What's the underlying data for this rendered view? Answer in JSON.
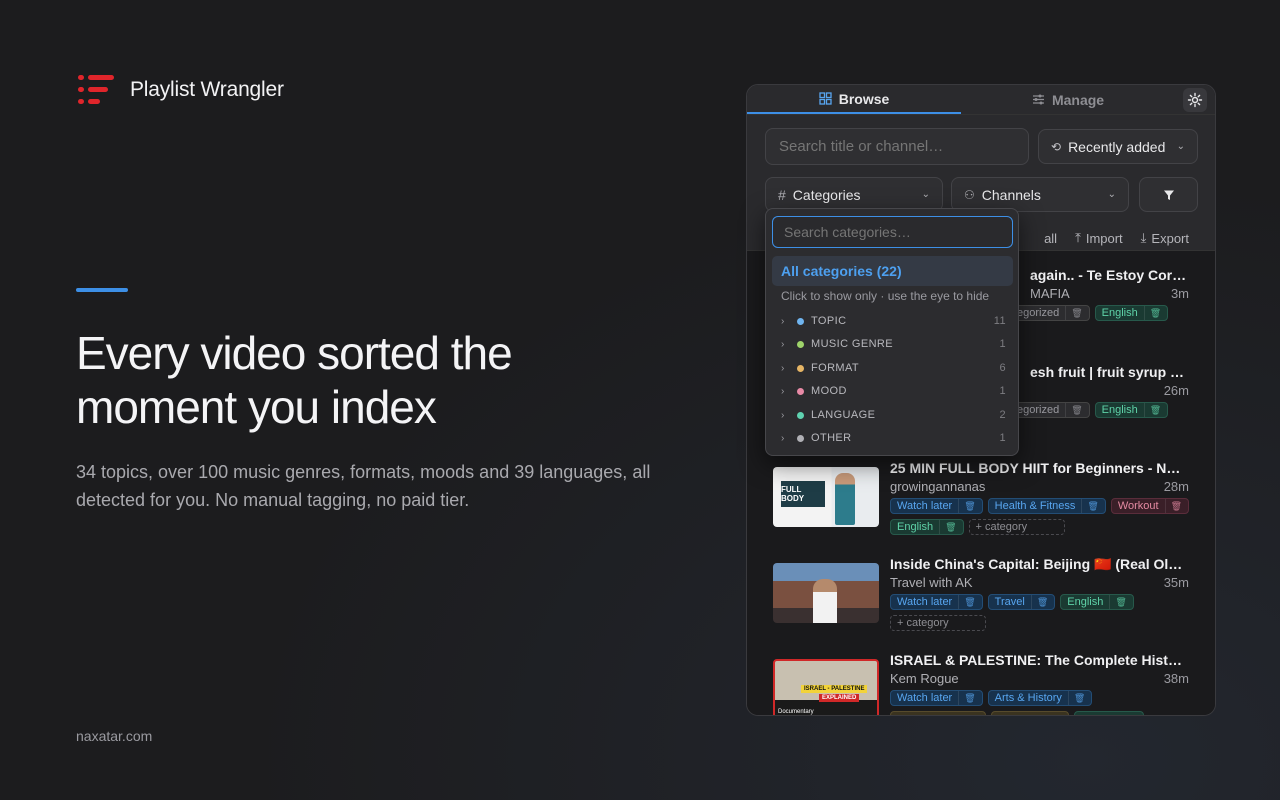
{
  "brand": {
    "name": "Playlist Wrangler",
    "logo": "list-logo-icon"
  },
  "hero": {
    "headline": "Every video sorted the moment you index",
    "sub": "34 topics, over 100 music genres, formats, moods and 39 languages, all detected for you. No manual tagging, no paid tier."
  },
  "footer": {
    "url": "naxatar.com"
  },
  "panel": {
    "tabs": [
      {
        "label": "Browse",
        "icon": "grid-icon"
      },
      {
        "label": "Manage",
        "icon": "sliders-icon"
      }
    ],
    "search_placeholder": "Search title or channel…",
    "sort": "Recently added",
    "categories_label": "Categories",
    "channels_label": "Channels",
    "toolbar": {
      "all": "all",
      "import": "Import",
      "export": "Export"
    },
    "colors": {
      "accent": "#3d8fe6",
      "brand_red": "#e0252b"
    }
  },
  "dropdown": {
    "search_placeholder": "Search categories…",
    "all_label": "All categories (22)",
    "hint": "Click to show only · use the eye to hide",
    "groups": [
      {
        "label": "TOPIC",
        "count": "11",
        "color": "#6fb4ef"
      },
      {
        "label": "MUSIC GENRE",
        "count": "1",
        "color": "#9ed36a"
      },
      {
        "label": "FORMAT",
        "count": "6",
        "color": "#e6b565"
      },
      {
        "label": "MOOD",
        "count": "1",
        "color": "#e88aa6"
      },
      {
        "label": "LANGUAGE",
        "count": "2",
        "color": "#5fd2b0"
      },
      {
        "label": "OTHER",
        "count": "1",
        "color": "#b0b0b5"
      }
    ]
  },
  "videos": [
    {
      "title": "again.. - Te Estoy Corret...",
      "channel": "MAFIA",
      "duration": "3m",
      "chips": [
        "egorized",
        "English"
      ]
    },
    {
      "title": "esh fruit | fruit syrup an...",
      "channel": "",
      "duration": "26m",
      "chips": [
        "egorized",
        "English"
      ]
    },
    {
      "title": "25 MIN FULL BODY HIIT for Beginners - No ...",
      "channel": "growingannanas",
      "duration": "28m",
      "chips": [
        "Watch later",
        "Health & Fitness",
        "Workout",
        "English",
        "+ category"
      ]
    },
    {
      "title": "Inside China's Capital: Beijing 🇨🇳 (Real Old ...",
      "channel": "Travel with AK",
      "duration": "35m",
      "chips": [
        "Watch later",
        "Travel",
        "English",
        "+ category"
      ]
    },
    {
      "title": "ISRAEL & PALESTINE: The Complete Histor...",
      "channel": "Kem Rogue",
      "duration": "38m",
      "chips": [
        "Watch later",
        "Arts & History"
      ]
    }
  ],
  "thumbs": {
    "fitness_text": "FULL BODY",
    "israel_text": "ISRAEL - PALESTINE",
    "israel_sub": "EXPLAINED",
    "doc": "Documentary"
  }
}
